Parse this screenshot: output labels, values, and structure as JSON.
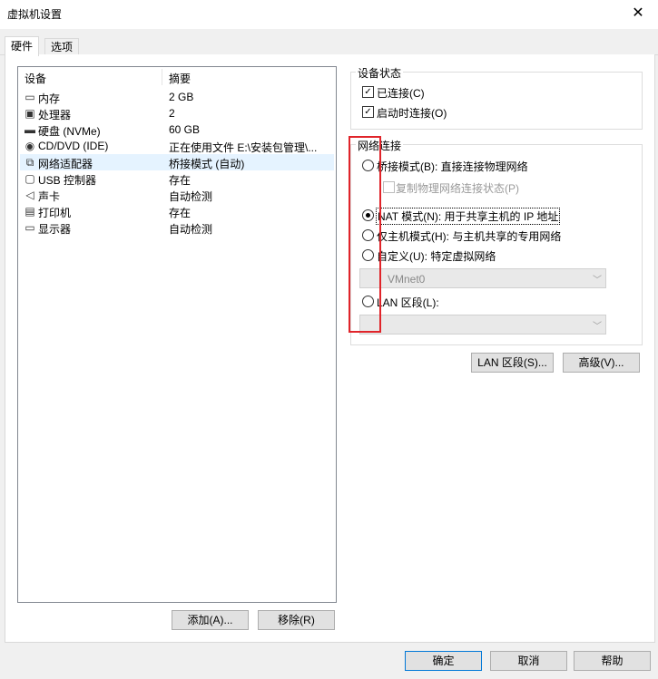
{
  "window": {
    "title": "虚拟机设置",
    "close_glyph": "✕"
  },
  "tabs": [
    {
      "label": "硬件"
    },
    {
      "label": "选项"
    }
  ],
  "device_list": {
    "headers": {
      "device": "设备",
      "summary": "摘要"
    },
    "rows": [
      {
        "icon": "memory-icon",
        "glyph": "▭",
        "name": "内存",
        "summary": "2 GB"
      },
      {
        "icon": "cpu-icon",
        "glyph": "▣",
        "name": "处理器",
        "summary": "2"
      },
      {
        "icon": "disk-icon",
        "glyph": "▬",
        "name": "硬盘 (NVMe)",
        "summary": "60 GB"
      },
      {
        "icon": "cd-icon",
        "glyph": "◉",
        "name": "CD/DVD (IDE)",
        "summary": "正在使用文件 E:\\安装包管理\\..."
      },
      {
        "icon": "network-icon",
        "glyph": "⧉",
        "name": "网络适配器",
        "summary": "桥接模式 (自动)"
      },
      {
        "icon": "usb-icon",
        "glyph": "▢",
        "name": "USB 控制器",
        "summary": "存在"
      },
      {
        "icon": "sound-icon",
        "glyph": "◁",
        "name": "声卡",
        "summary": "自动检测"
      },
      {
        "icon": "printer-icon",
        "glyph": "▤",
        "name": "打印机",
        "summary": "存在"
      },
      {
        "icon": "display-icon",
        "glyph": "▭",
        "name": "显示器",
        "summary": "自动检测"
      }
    ]
  },
  "list_buttons": {
    "add": "添加(A)...",
    "remove": "移除(R)"
  },
  "device_status": {
    "title": "设备状态",
    "connected": {
      "label": "已连接(C)",
      "checked": true
    },
    "connect_at_power_on": {
      "label": "启动时连接(O)",
      "checked": true
    }
  },
  "network": {
    "title": "网络连接",
    "bridged": {
      "label": "桥接模式(B): 直接连接物理网络",
      "selected": false
    },
    "replicate": {
      "label": "复制物理网络连接状态(P)",
      "checked": false
    },
    "nat": {
      "label": "NAT 模式(N): 用于共享主机的 IP 地址",
      "selected": true
    },
    "host_only": {
      "label": "仅主机模式(H): 与主机共享的专用网络",
      "selected": false
    },
    "custom": {
      "label": "自定义(U): 特定虚拟网络",
      "selected": false
    },
    "custom_value": "VMnet0",
    "lan": {
      "label": "LAN 区段(L):",
      "selected": false
    },
    "lan_value": ""
  },
  "net_buttons": {
    "lan_segments": "LAN 区段(S)...",
    "advanced": "高级(V)..."
  },
  "footer": {
    "ok": "确定",
    "cancel": "取消",
    "help": "帮助"
  },
  "colors": {
    "selection": "#e5f3ff",
    "highlight_box": "#e0242a",
    "default_button_border": "#0078d7"
  }
}
